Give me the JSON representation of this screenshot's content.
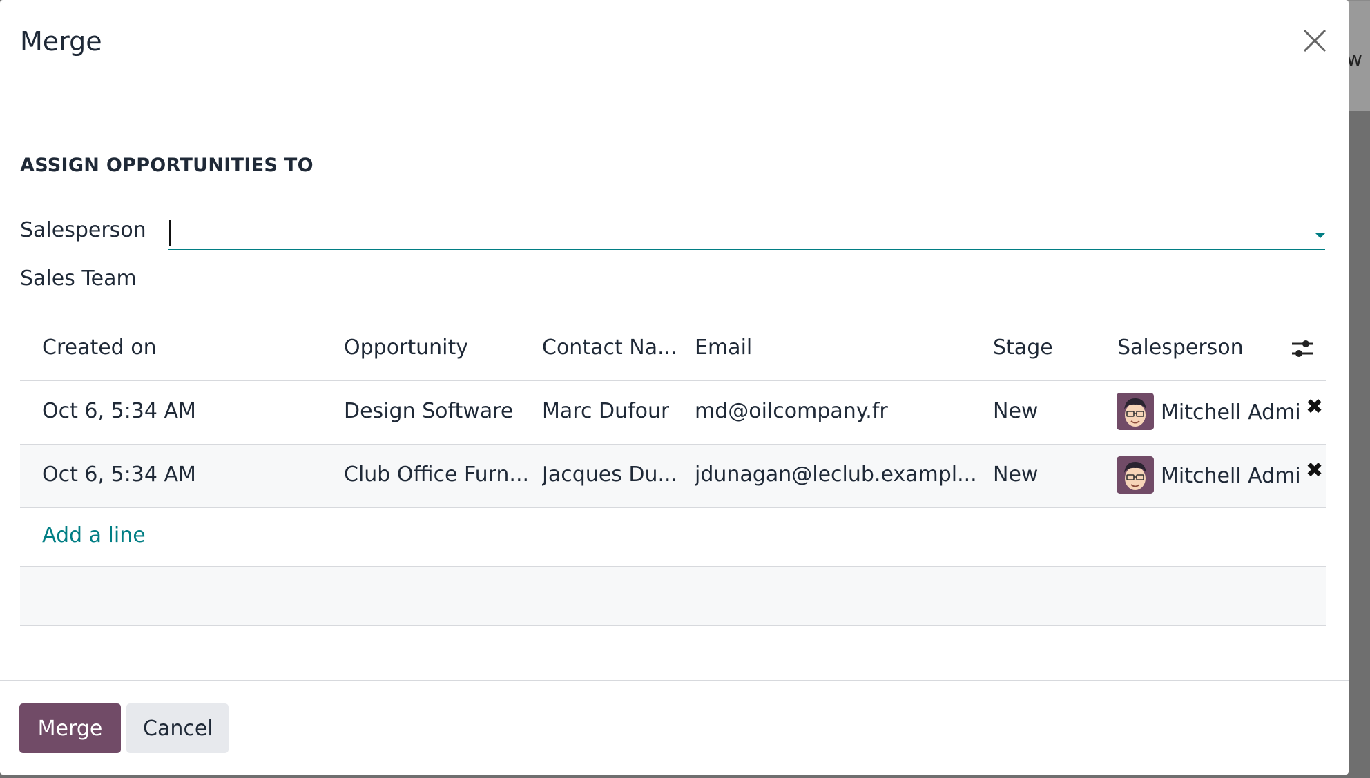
{
  "background": {
    "partial_text": "w"
  },
  "dialog": {
    "title": "Merge",
    "section_title": "ASSIGN OPPORTUNITIES TO",
    "fields": {
      "salesperson_label": "Salesperson",
      "salesperson_value": "",
      "sales_team_label": "Sales Team"
    },
    "table": {
      "columns": [
        "Created on",
        "Opportunity",
        "Contact Na...",
        "Email",
        "Stage",
        "Salesperson"
      ],
      "rows": [
        {
          "created_on": "Oct 6, 5:34 AM",
          "opportunity": "Design Software",
          "contact": "Marc Dufour",
          "email": "md@oilcompany.fr",
          "stage": "New",
          "salesperson": "Mitchell Admin"
        },
        {
          "created_on": "Oct 6, 5:34 AM",
          "opportunity": "Club Office Furn...",
          "contact": "Jacques Du...",
          "email": "jdunagan@leclub.exampl...",
          "stage": "New",
          "salesperson": "Mitchell Admin"
        }
      ],
      "add_line_label": "Add a line"
    },
    "buttons": {
      "merge": "Merge",
      "cancel": "Cancel"
    }
  },
  "icons": {
    "close": "close-icon",
    "dropdown": "caret-down-icon",
    "settings": "optional-columns-icon",
    "remove": "remove-icon",
    "avatar": "user-avatar"
  },
  "colors": {
    "primary": "#714b67",
    "accent": "#017e84",
    "border": "#d7d9dd"
  }
}
